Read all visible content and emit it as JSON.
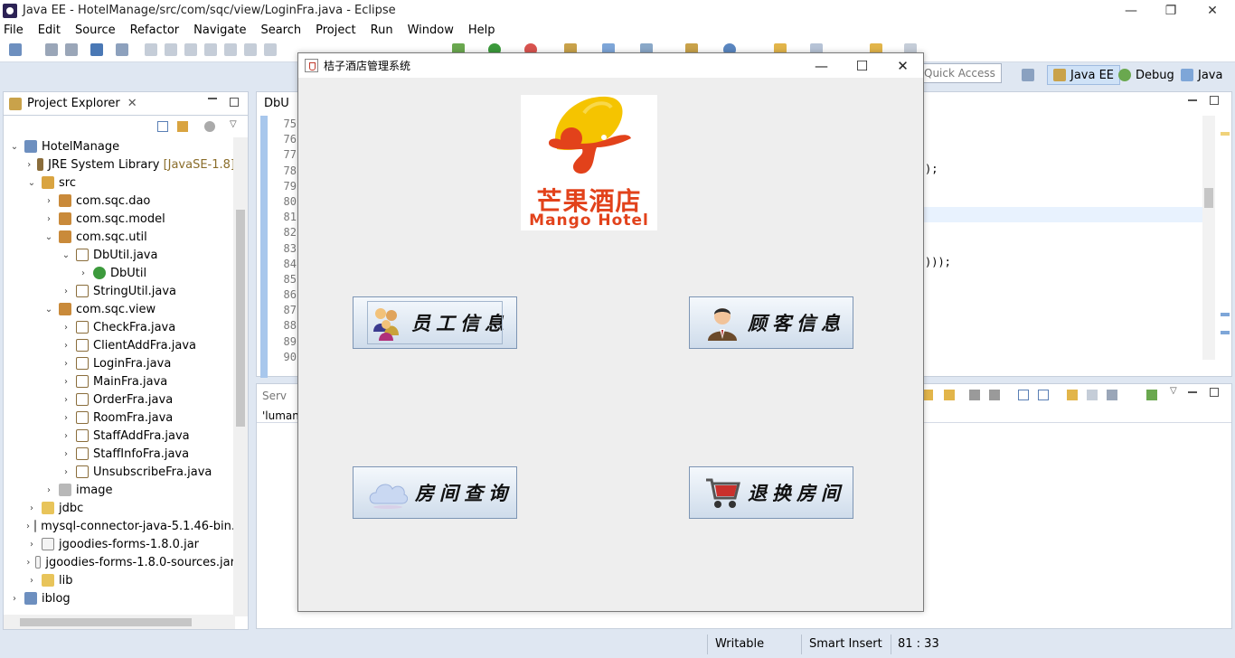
{
  "window": {
    "title": "Java EE - HotelManage/src/com/sqc/view/LoginFra.java - Eclipse",
    "min": "—",
    "max": "❐",
    "close": "✕"
  },
  "menu": [
    "File",
    "Edit",
    "Source",
    "Refactor",
    "Navigate",
    "Search",
    "Project",
    "Run",
    "Window",
    "Help"
  ],
  "toolbar": {
    "quick_access": "Quick Access",
    "perspectives": [
      "Java EE",
      "Debug",
      "Java"
    ]
  },
  "project_explorer": {
    "tab_label": "Project Explorer",
    "tab_close": "✕",
    "items": [
      {
        "label": "HotelManage",
        "twisty": "⌄"
      },
      {
        "label": "JRE System Library",
        "suffix": "[JavaSE-1.8]",
        "twisty": "›"
      },
      {
        "label": "src",
        "twisty": "⌄"
      },
      {
        "label": "com.sqc.dao",
        "twisty": "›"
      },
      {
        "label": "com.sqc.model",
        "twisty": "›"
      },
      {
        "label": "com.sqc.util",
        "twisty": "⌄"
      },
      {
        "label": "DbUtil.java",
        "twisty": "⌄"
      },
      {
        "label": "DbUtil",
        "twisty": "›"
      },
      {
        "label": "StringUtil.java",
        "twisty": "›"
      },
      {
        "label": "com.sqc.view",
        "twisty": "⌄"
      },
      {
        "label": "CheckFra.java",
        "twisty": "›"
      },
      {
        "label": "ClientAddFra.java",
        "twisty": "›"
      },
      {
        "label": "LoginFra.java",
        "twisty": "›"
      },
      {
        "label": "MainFra.java",
        "twisty": "›"
      },
      {
        "label": "OrderFra.java",
        "twisty": "›"
      },
      {
        "label": "RoomFra.java",
        "twisty": "›"
      },
      {
        "label": "StaffAddFra.java",
        "twisty": "›"
      },
      {
        "label": "StaffInfoFra.java",
        "twisty": "›"
      },
      {
        "label": "UnsubscribeFra.java",
        "twisty": "›"
      },
      {
        "label": "image",
        "twisty": "›"
      },
      {
        "label": "jdbc",
        "twisty": "›"
      },
      {
        "label": "mysql-connector-java-5.1.46-bin.",
        "twisty": "›"
      },
      {
        "label": "jgoodies-forms-1.8.0.jar",
        "twisty": "›"
      },
      {
        "label": "jgoodies-forms-1.8.0-sources.jar",
        "twisty": "›"
      },
      {
        "label": "lib",
        "twisty": "›"
      },
      {
        "label": "iblog",
        "twisty": "›"
      }
    ]
  },
  "editor": {
    "tab_label": "DbU",
    "line_numbers": [
      "75",
      "76",
      "77",
      "78",
      "79",
      "80",
      "81",
      "82",
      "83",
      "84",
      "85",
      "86",
      "87",
      "88",
      "89",
      "90"
    ],
    "frag1": ");",
    "frag2": ")));"
  },
  "bottom_panel": {
    "tab_label": "Serv",
    "row_text": "'luman"
  },
  "status": {
    "writable": "Writable",
    "insert_mode": "Smart Insert",
    "position": "81 : 33"
  },
  "dialog": {
    "title": "桔子酒店管理系统",
    "min": "—",
    "max": "☐",
    "close": "✕",
    "logo_cn": "芒果酒店",
    "logo_en": "Mango Hotel",
    "buttons": {
      "staff": "员工信息",
      "customer": "顾客信息",
      "room_query": "房间查询",
      "checkout": "退换房间"
    }
  }
}
